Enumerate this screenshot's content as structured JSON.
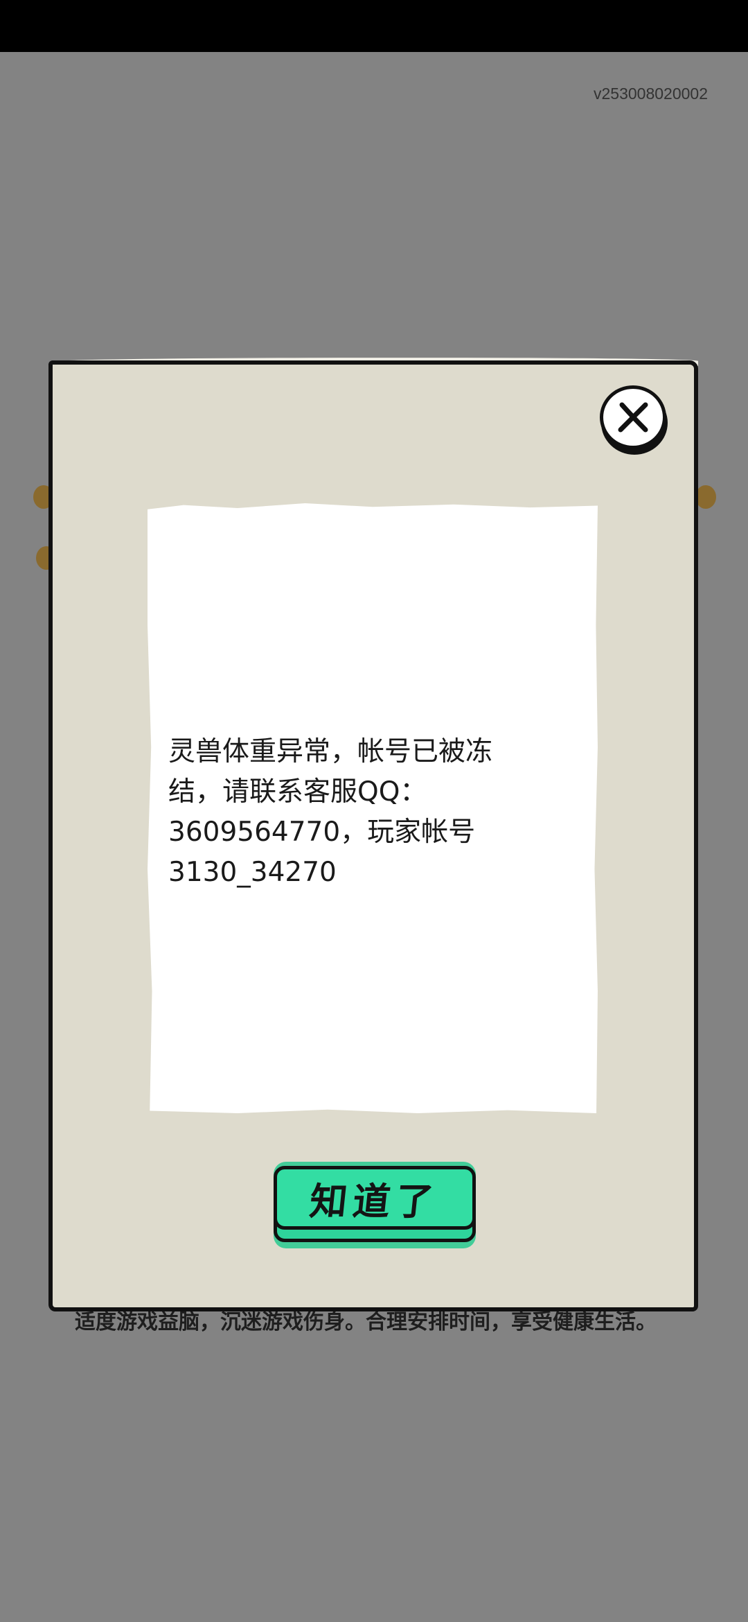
{
  "app": {
    "version": "v253008020002"
  },
  "background": {
    "notice_text": "适度游戏益脑，沉迷游戏伤身。合理安排时间，享受健康生活。"
  },
  "dialog": {
    "message": "灵兽体重异常，帐号已被冻\n结，请联系客服QQ：\n3609564770，玩家帐号\n3130_34270",
    "confirm_label": "知道了",
    "close_icon": "close-icon"
  },
  "colors": {
    "overlay": "#838383",
    "dialog_bg": "#dedbcd",
    "panel_bg": "#ffffff",
    "confirm_button": "#33dda3",
    "outline": "#111111"
  }
}
